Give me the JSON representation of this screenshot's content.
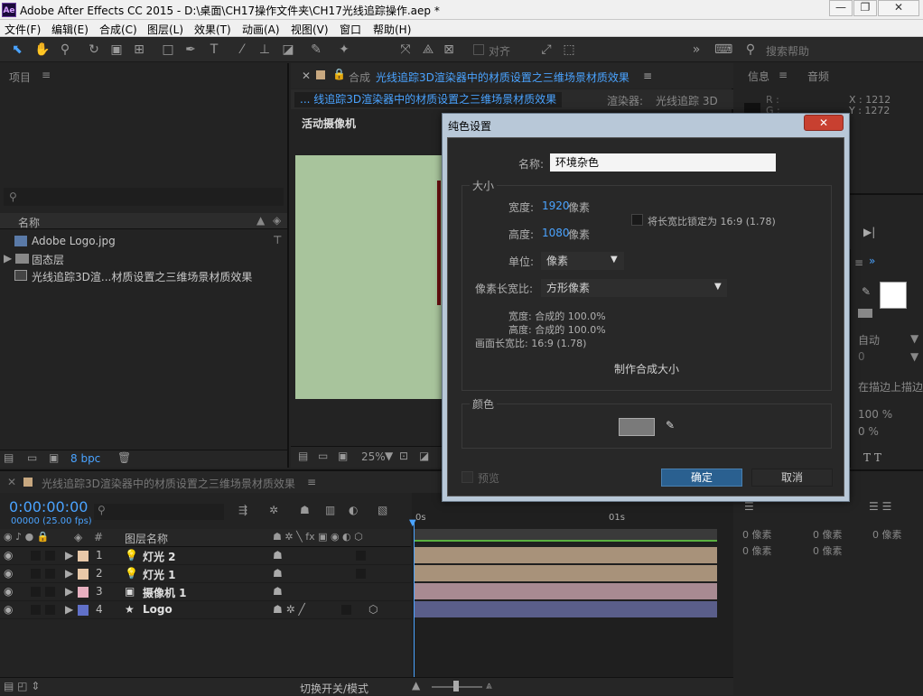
{
  "title": "Adobe After Effects CC 2015 - D:\\桌面\\CH17操作文件夹\\CH17光线追踪操作.aep *",
  "app_icon": "Ae",
  "window_buttons": [
    "—",
    "❐",
    "✕"
  ],
  "menu": [
    "文件(F)",
    "编辑(E)",
    "合成(C)",
    "图层(L)",
    "效果(T)",
    "动画(A)",
    "视图(V)",
    "窗口",
    "帮助(H)"
  ],
  "toolbar": {
    "snap_label": "对齐",
    "search_placeholder": "搜索帮助"
  },
  "project": {
    "title": "项目",
    "col_name": "名称",
    "items": [
      "Adobe Logo.jpg",
      "固态层",
      "光线追踪3D渲...材质设置之三维场景材质效果"
    ],
    "bpc": "8 bpc"
  },
  "comp": {
    "title": "合成",
    "name": "光线追踪3D渲染器中的材质设置之三维场景材质效果",
    "breadcrumb": "... 线追踪3D渲染器中的材质设置之三维场景材质效果",
    "renderer_label": "渲染器:",
    "renderer_value": "光线追踪 3D",
    "camera_label": "活动摄像机",
    "zoom": "25%"
  },
  "info": {
    "tab_info": "信息",
    "tab_audio": "音频",
    "r": "R :",
    "g": "G :",
    "x": "X : 1212",
    "y": "Y : 1272"
  },
  "char": {
    "auto": "自动",
    "zero": "0",
    "stroke": "在描边上描边",
    "pct1": "100 %",
    "pct2": "0 %"
  },
  "para": {
    "px": [
      "0 像素",
      "0 像素",
      "0 像素",
      "0 像素",
      "0 像素"
    ]
  },
  "dialog": {
    "title": "纯色设置",
    "name_label": "名称:",
    "name_value": "环境杂色",
    "size_title": "大小",
    "width_label": "宽度:",
    "width_value": "1920",
    "height_label": "高度:",
    "height_value": "1080",
    "px": "像素",
    "lock_label": "将长宽比锁定为 16:9 (1.78)",
    "unit_label": "单位:",
    "unit_value": "像素",
    "par_label": "像素长宽比:",
    "par_value": "方形像素",
    "w_pct": "宽度: 合成的 100.0%",
    "h_pct": "高度: 合成的 100.0%",
    "frame_ar": "画面长宽比: 16:9 (1.78)",
    "make_comp": "制作合成大小",
    "color_title": "颜色",
    "color_value": "#7a7a7a",
    "preview": "预览",
    "ok": "确定",
    "cancel": "取消"
  },
  "timeline": {
    "tab": "光线追踪3D渲染器中的材质设置之三维场景材质效果",
    "timecode": "0:00:00:00",
    "frames": "00000 (25.00 fps)",
    "col_layer": "图层名称",
    "col_num": "#",
    "ruler": [
      "0s",
      "01s"
    ],
    "switch_label": "切换开关/模式",
    "layers": [
      {
        "num": "1",
        "name": "灯光 2",
        "color": "#e8c8a8",
        "bar": "#a8927a"
      },
      {
        "num": "2",
        "name": "灯光 1",
        "color": "#e8c8a8",
        "bar": "#a8927a"
      },
      {
        "num": "3",
        "name": "摄像机 1",
        "color": "#e8b0c0",
        "bar": "#a88a92"
      },
      {
        "num": "4",
        "name": "Logo",
        "color": "#6070c8",
        "bar": "#5a5e8a"
      }
    ]
  }
}
